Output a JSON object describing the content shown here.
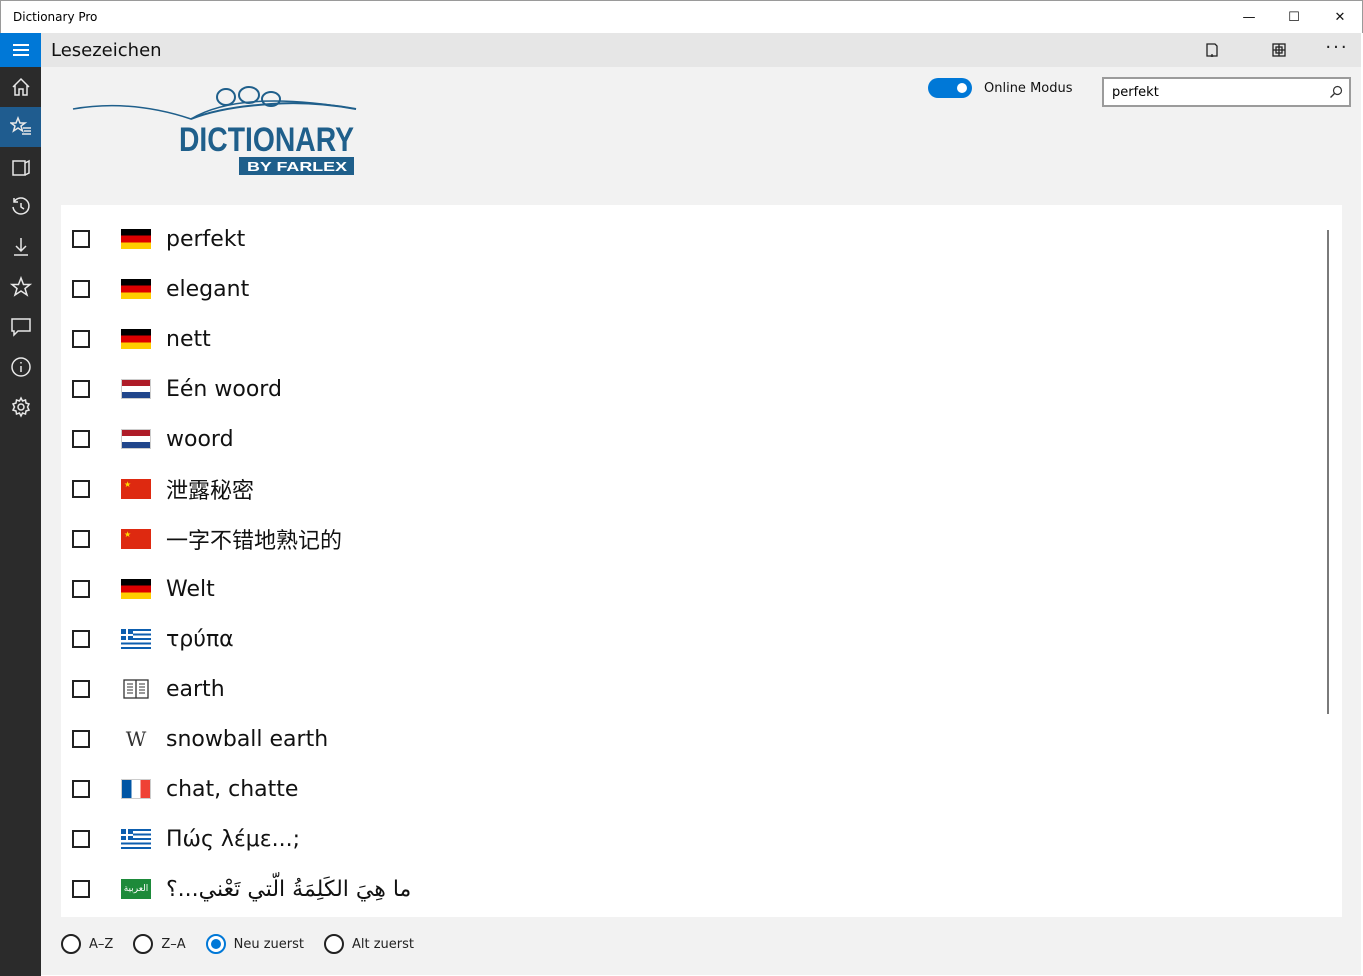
{
  "window": {
    "title": "Dictionary Pro",
    "minimize_glyph": "—",
    "maximize_glyph": "☐",
    "close_glyph": "✕"
  },
  "header": {
    "title": "Lesezeichen",
    "more_glyph": "···"
  },
  "sidebar": {
    "items": [
      {
        "icon": "home-icon"
      },
      {
        "icon": "bookmarks-icon",
        "active": true
      },
      {
        "icon": "flashcards-icon"
      },
      {
        "icon": "history-icon"
      },
      {
        "icon": "download-icon"
      },
      {
        "icon": "star-icon"
      },
      {
        "icon": "feedback-icon"
      },
      {
        "icon": "info-icon"
      },
      {
        "icon": "settings-icon"
      }
    ]
  },
  "logo": {
    "main": "DICTIONARY",
    "sub": "BY FARLEX"
  },
  "online_mode": {
    "label": "Online Modus",
    "enabled": true
  },
  "search": {
    "value": "perfekt",
    "placeholder": ""
  },
  "bookmarks": [
    {
      "word": "perfekt",
      "flag": "de",
      "checked": false
    },
    {
      "word": "elegant",
      "flag": "de",
      "checked": false
    },
    {
      "word": "nett",
      "flag": "de",
      "checked": false
    },
    {
      "word": "Eén woord",
      "flag": "nl",
      "checked": false
    },
    {
      "word": "woord",
      "flag": "nl",
      "checked": false
    },
    {
      "word": "泄露秘密",
      "flag": "cn",
      "checked": false
    },
    {
      "word": "一字不错地熟记的",
      "flag": "cn",
      "checked": false
    },
    {
      "word": "Welt",
      "flag": "de",
      "checked": false
    },
    {
      "word": "τρύπα",
      "flag": "gr",
      "checked": false
    },
    {
      "word": "earth",
      "flag": "book",
      "checked": false
    },
    {
      "word": "snowball earth",
      "flag": "wiki",
      "checked": false
    },
    {
      "word": "chat, chatte",
      "flag": "fr",
      "checked": false
    },
    {
      "word": "Πώς λέμε...;",
      "flag": "gr",
      "checked": false
    },
    {
      "word": "ما هِيَ الكَلِمَةُ الّتي تَعْني...؟",
      "flag": "ar",
      "checked": false
    }
  ],
  "flag_labels": {
    "ar": "العربية",
    "wiki": "W"
  },
  "sort": {
    "options": [
      {
        "label": "A–Z",
        "selected": false
      },
      {
        "label": "Z–A",
        "selected": false
      },
      {
        "label": "Neu zuerst",
        "selected": true
      },
      {
        "label": "Alt zuerst",
        "selected": false
      }
    ]
  },
  "colors": {
    "accent": "#0078d7",
    "sidebar": "#2b2b2b",
    "header": "#e6e6e6",
    "logo_blue": "#1f5f8b"
  }
}
